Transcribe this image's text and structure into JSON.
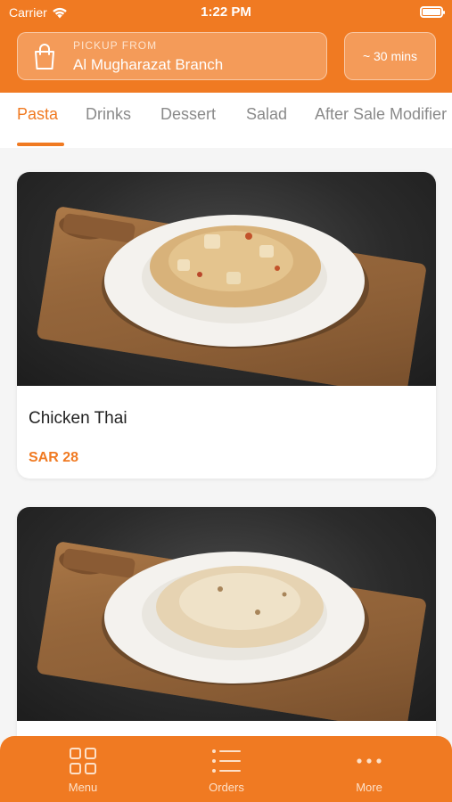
{
  "status_bar": {
    "carrier": "Carrier",
    "time": "1:22 PM"
  },
  "pickup": {
    "label": "PICKUP FROM",
    "branch": "Al Mugharazat Branch"
  },
  "eta": "~ 30 mins",
  "tabs": [
    {
      "label": "Pasta"
    },
    {
      "label": "Drinks"
    },
    {
      "label": "Dessert"
    },
    {
      "label": "Salad"
    },
    {
      "label": "After Sale Modifier"
    }
  ],
  "items": [
    {
      "name": "Chicken Thai",
      "price": "SAR 28"
    },
    {
      "name": "",
      "price": ""
    }
  ],
  "bottom_nav": [
    {
      "label": "Menu",
      "icon": "grid-icon"
    },
    {
      "label": "Orders",
      "icon": "list-icon"
    },
    {
      "label": "More",
      "icon": "more-icon"
    }
  ],
  "colors": {
    "accent": "#f07a22",
    "background": "#f5f5f5"
  }
}
